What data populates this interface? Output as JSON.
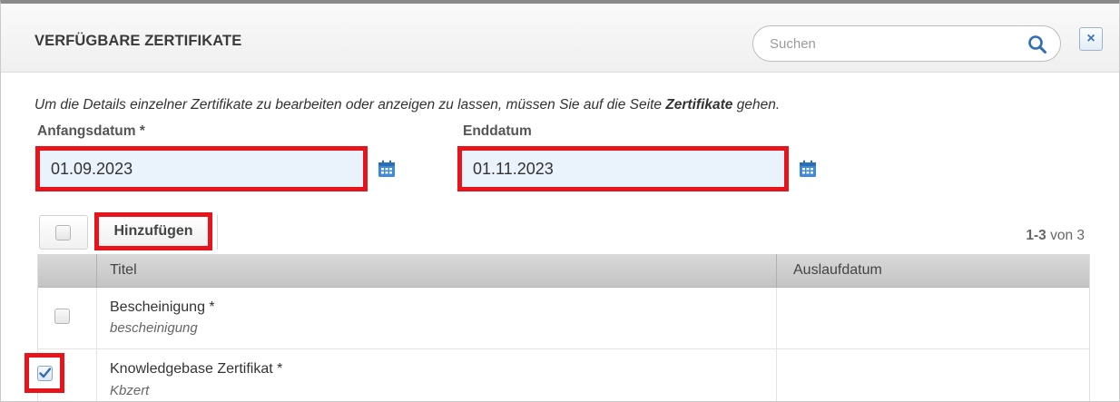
{
  "dialog": {
    "title": "VERFÜGBARE ZERTIFIKATE",
    "search_placeholder": "Suchen",
    "close_label": "×"
  },
  "hint": {
    "text_before": "Um die Details einzelner Zertifikate zu bearbeiten oder anzeigen zu lassen, müssen Sie auf die Seite ",
    "link_text": "Zertifikate",
    "text_after": " gehen."
  },
  "dates": {
    "start_label": "Anfangsdatum *",
    "start_value": "01.09.2023",
    "end_label": "Enddatum",
    "end_value": "01.11.2023"
  },
  "toolbar": {
    "add_label": "Hinzufügen"
  },
  "pager": {
    "range": "1-3",
    "suffix": " von 3"
  },
  "table": {
    "columns": [
      "Titel",
      "Auslaufdatum"
    ],
    "rows": [
      {
        "title": "Bescheinigung *",
        "subtitle": "bescheinigung",
        "expiry": "",
        "checked": false
      },
      {
        "title": "Knowledgebase Zertifikat *",
        "subtitle": "Kbzert",
        "expiry": "",
        "checked": true
      }
    ]
  },
  "colors": {
    "highlight": "#e8141c",
    "accent": "#3c74b4",
    "input_bg": "#eaf2fb"
  }
}
